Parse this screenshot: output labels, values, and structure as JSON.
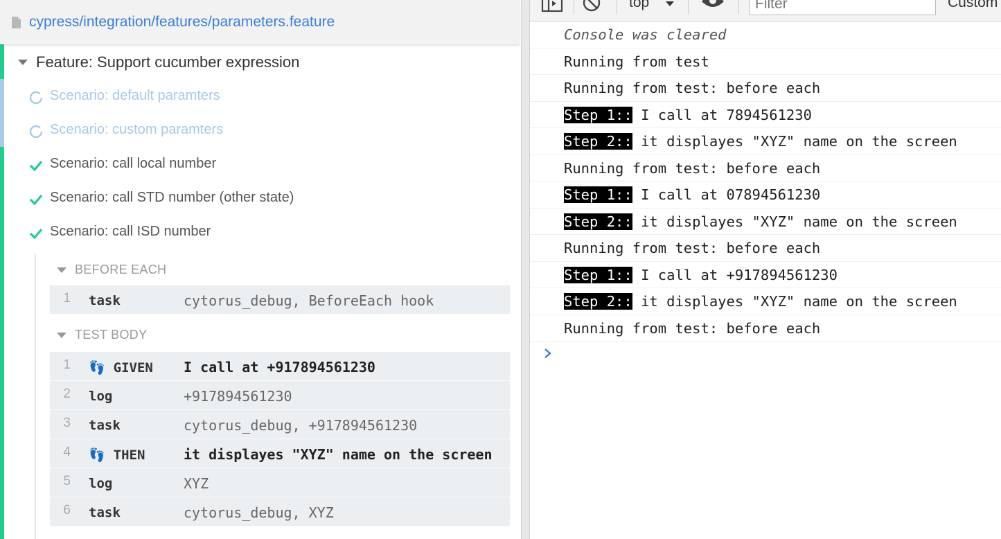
{
  "runner": {
    "file_path": "cypress/integration/features/parameters.feature",
    "feature_title": "Feature: Support cucumber expression",
    "scenarios": [
      {
        "label": "Scenario: default paramters",
        "state": "pending"
      },
      {
        "label": "Scenario: custom paramters",
        "state": "pending"
      },
      {
        "label": "Scenario: call local number",
        "state": "passed"
      },
      {
        "label": "Scenario: call STD number (other state)",
        "state": "passed"
      },
      {
        "label": "Scenario: call ISD number",
        "state": "passed"
      }
    ],
    "before_each": {
      "header": "BEFORE EACH",
      "commands": [
        {
          "num": "1",
          "name": "task",
          "message": "cytorus_debug, BeforeEach hook"
        }
      ]
    },
    "test_body": {
      "header": "TEST BODY",
      "commands": [
        {
          "num": "1",
          "name": "GIVEN",
          "message": "I call at +917894561230",
          "step": true
        },
        {
          "num": "2",
          "name": "log",
          "message": "+917894561230"
        },
        {
          "num": "3",
          "name": "task",
          "message": "cytorus_debug, +917894561230"
        },
        {
          "num": "4",
          "name": "THEN",
          "message": "it displayes \"XYZ\" name on the screen",
          "step": true
        },
        {
          "num": "5",
          "name": "log",
          "message": "XYZ"
        },
        {
          "num": "6",
          "name": "task",
          "message": "cytorus_debug, XYZ"
        }
      ]
    },
    "colors": {
      "passed": "#1fcf8d",
      "pending": "#a9c9ec",
      "link": "#3b7dd8"
    }
  },
  "devtools": {
    "toolbar": {
      "context": "top",
      "filter_placeholder": "Filter",
      "levels_label": "Custom"
    },
    "console": [
      {
        "text": "Console was cleared",
        "kind": "cleared"
      },
      {
        "text": "Running from test"
      },
      {
        "text": "Running from test: before each"
      },
      {
        "tag": "Step 1::",
        "text": " I call at 7894561230"
      },
      {
        "tag": "Step 2::",
        "text": " it displayes \"XYZ\" name on the screen"
      },
      {
        "text": "Running from test: before each"
      },
      {
        "tag": "Step 1::",
        "text": " I call at 07894561230"
      },
      {
        "tag": "Step 2::",
        "text": " it displayes \"XYZ\" name on the screen"
      },
      {
        "text": "Running from test: before each"
      },
      {
        "tag": "Step 1::",
        "text": " I call at +917894561230"
      },
      {
        "tag": "Step 2::",
        "text": " it displayes \"XYZ\" name on the screen"
      },
      {
        "text": "Running from test: before each"
      }
    ]
  }
}
